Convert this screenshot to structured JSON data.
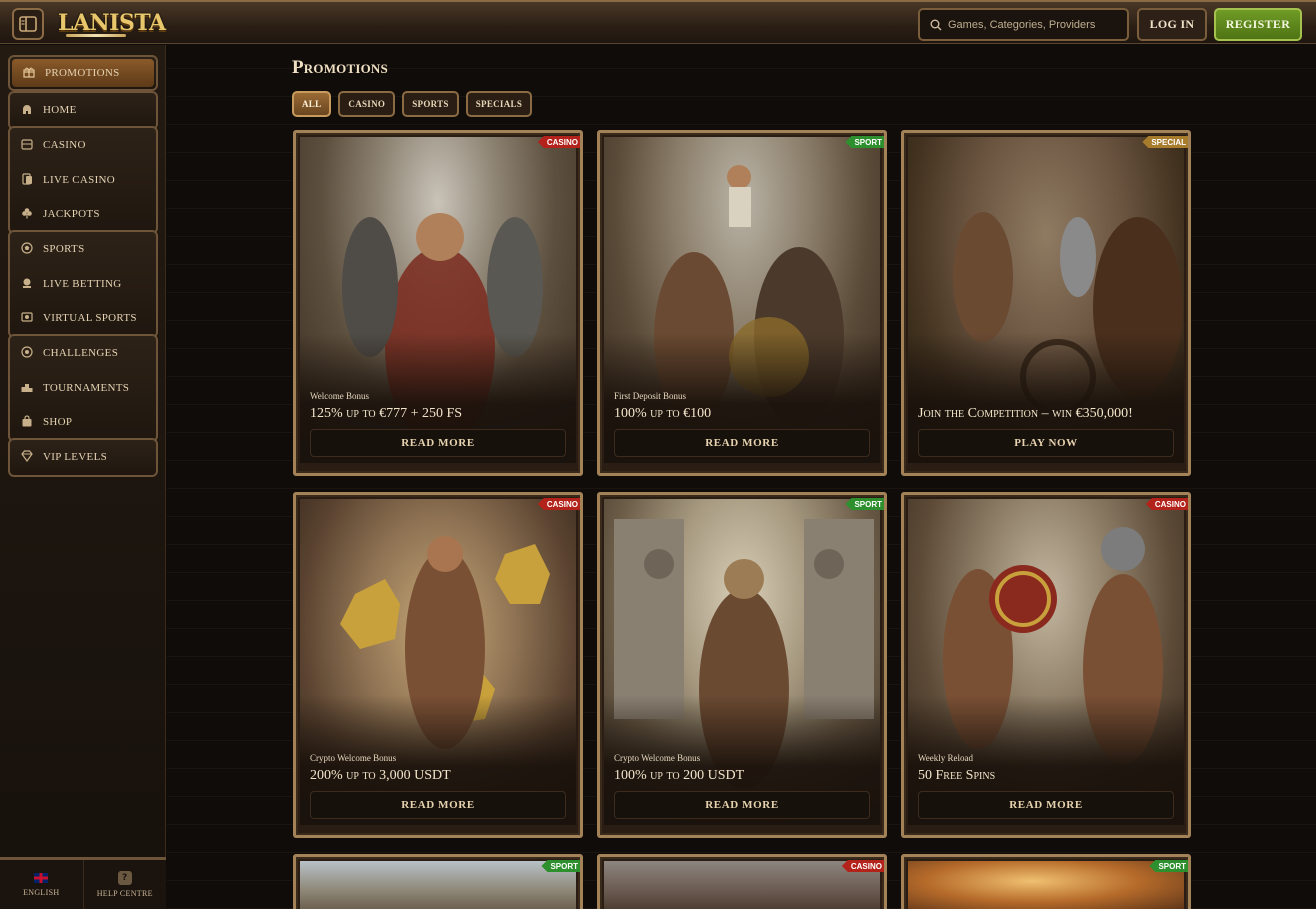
{
  "header": {
    "logo_text": "LANISTA",
    "search_placeholder": "Games, Categories, Providers",
    "login_label": "LOG IN",
    "register_label": "REGISTER"
  },
  "sidebar": {
    "groups": [
      {
        "items": [
          {
            "label": "PROMOTIONS",
            "icon": "gift-icon",
            "active": true
          }
        ]
      },
      {
        "items": [
          {
            "label": "HOME",
            "icon": "helmet-icon"
          }
        ]
      },
      {
        "items": [
          {
            "label": "CASINO",
            "icon": "slot-icon"
          },
          {
            "label": "LIVE CASINO",
            "icon": "cards-icon"
          },
          {
            "label": "JACKPOTS",
            "icon": "clover-icon"
          }
        ]
      },
      {
        "items": [
          {
            "label": "SPORTS",
            "icon": "ball-icon"
          },
          {
            "label": "LIVE BETTING",
            "icon": "live-icon"
          },
          {
            "label": "VIRTUAL SPORTS",
            "icon": "virtual-icon"
          }
        ]
      },
      {
        "items": [
          {
            "label": "CHALLENGES",
            "icon": "target-icon"
          },
          {
            "label": "TOURNAMENTS",
            "icon": "podium-icon"
          },
          {
            "label": "SHOP",
            "icon": "bag-icon"
          }
        ]
      },
      {
        "items": [
          {
            "label": "VIP LEVELS",
            "icon": "diamond-icon"
          }
        ]
      }
    ],
    "footer": {
      "language_label": "ENGLISH",
      "help_label": "HELP CENTRE"
    }
  },
  "main": {
    "title": "Promotions",
    "filters": [
      "ALL",
      "CASINO",
      "SPORTS",
      "SPECIALS"
    ],
    "cards": [
      {
        "tag": "CASINO",
        "subtitle": "Welcome Bonus",
        "headline": "125% up to €777 + 250 FS",
        "cta": "READ MORE"
      },
      {
        "tag": "SPORT",
        "subtitle": "First Deposit Bonus",
        "headline": "100% up to €100",
        "cta": "READ MORE"
      },
      {
        "tag": "SPECIAL",
        "subtitle": "",
        "headline": "Join the Competition – win €350,000!",
        "cta": "PLAY NOW"
      },
      {
        "tag": "CASINO",
        "subtitle": "Crypto Welcome Bonus",
        "headline": "200% up to 3,000 USDT",
        "cta": "READ MORE"
      },
      {
        "tag": "SPORT",
        "subtitle": "Crypto Welcome Bonus",
        "headline": "100% up to 200 USDT",
        "cta": "READ MORE"
      },
      {
        "tag": "CASINO",
        "subtitle": "Weekly Reload",
        "headline": "50 Free Spins",
        "cta": "READ MORE"
      },
      {
        "tag": "SPORT"
      },
      {
        "tag": "CASINO"
      },
      {
        "tag": "SPORT"
      }
    ]
  },
  "colors": {
    "accent_gold": "#c8a06a",
    "register_green": "#6f9b25",
    "tag_casino": "#b3231b",
    "tag_sport": "#2e8f2e",
    "tag_special": "#a77c2d"
  }
}
